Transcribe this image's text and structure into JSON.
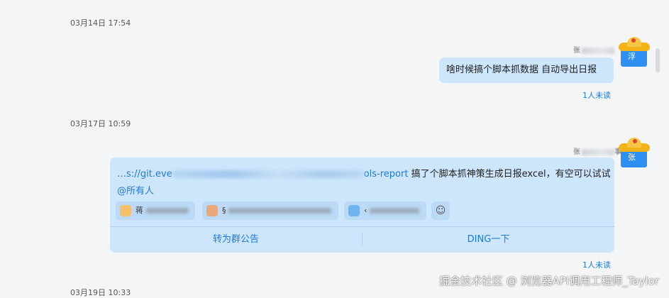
{
  "messages": [
    {
      "timestamp": "03月14日 17:54",
      "sender_name": "张",
      "avatar_text": "浮",
      "text": "啥时候搞个脚本抓数据 自动导出日报",
      "read_status": "1人未读"
    },
    {
      "timestamp": "03月17日 10:59",
      "sender_name": "张",
      "sender_name_tail": "事)",
      "avatar_text": "张",
      "link_prefix": "…s://git.eve",
      "link_suffix": "ols-report",
      "text": "搞了个脚本抓神策生成日报excel，有空可以试试",
      "mention": "@所有人",
      "reactions": [
        {
          "label": "蒋",
          "icon": "reaction-emoji-icon"
        },
        {
          "label": "§",
          "icon": "clap-emoji-icon"
        },
        {
          "label": "‹",
          "icon": "thumbs-up-icon"
        }
      ],
      "actions": {
        "announce": "转为群公告",
        "ding": "DING一下"
      },
      "read_status": "1人未读"
    },
    {
      "timestamp": "03月19日 10:33"
    }
  ],
  "watermark": "掘金技术社区 @ 浏览器API调用工程师_Taylor"
}
